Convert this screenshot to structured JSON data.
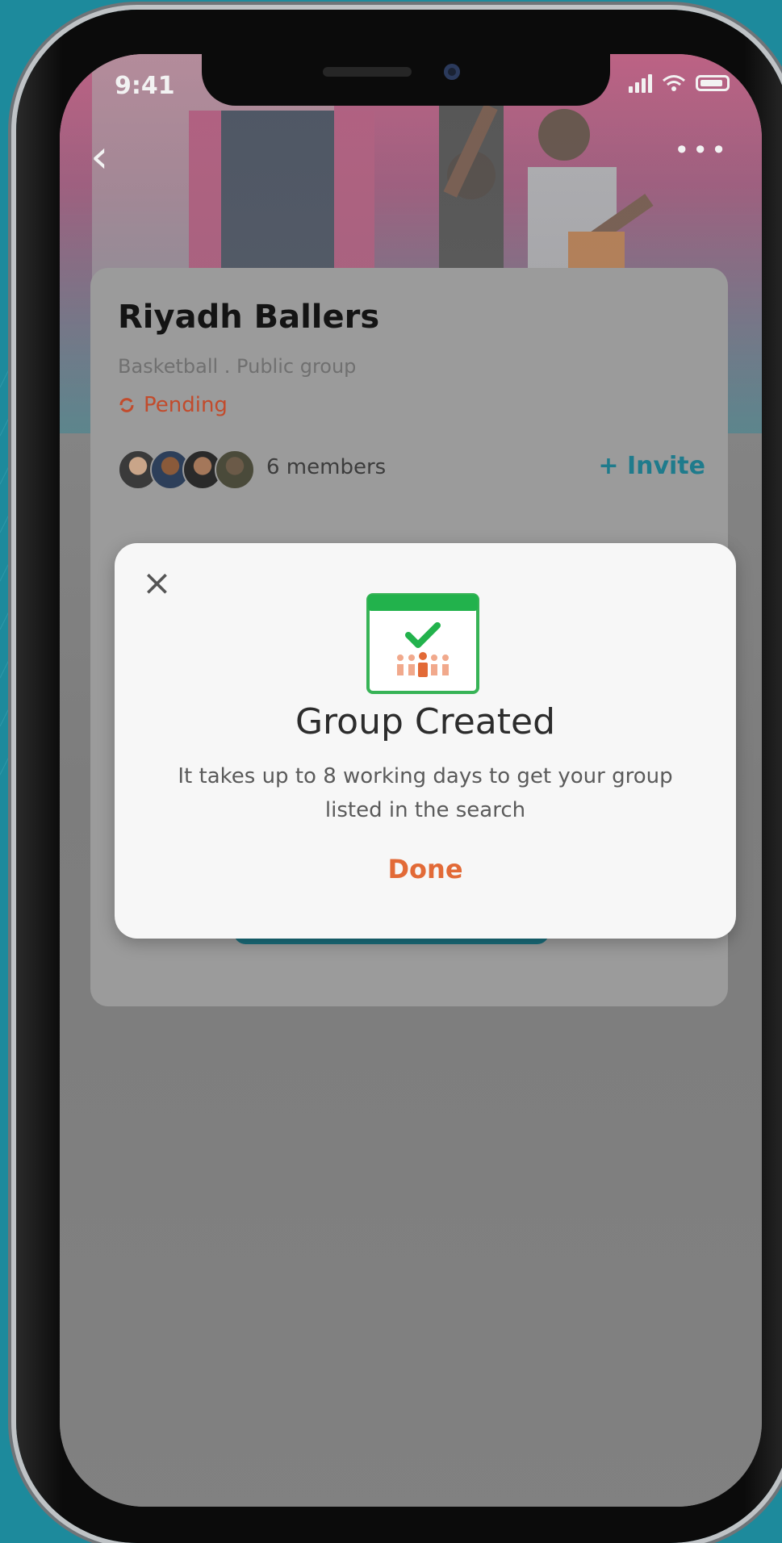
{
  "status_bar": {
    "time": "9:41"
  },
  "group": {
    "name": "Riyadh Ballers",
    "meta": "Basketball . Public group",
    "status": "Pending",
    "members": "6 members",
    "invite": "Invite",
    "invite_icon": "plus-icon",
    "status_icon": "sync-icon"
  },
  "modal": {
    "title": "Group Created",
    "message": "It takes up to 8 working days to get your group listed in the search",
    "done_label": "Done",
    "icon": "calendar-check-group-icon"
  },
  "colors": {
    "accent_teal": "#1f7b8c",
    "pending_red": "#c24b2c",
    "done_orange": "#e26a37",
    "success_green": "#22b24c"
  }
}
